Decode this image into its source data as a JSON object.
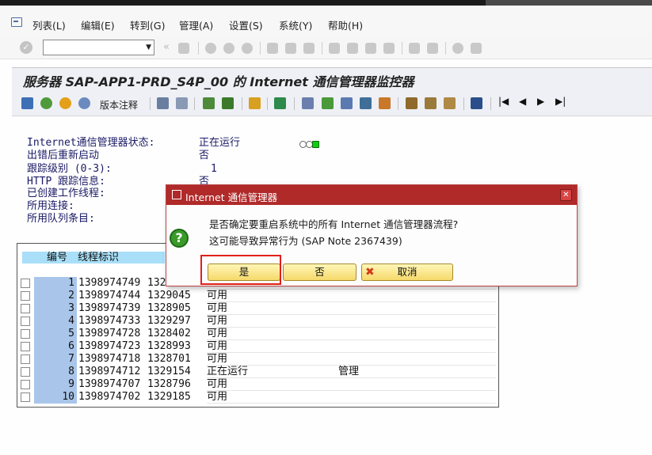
{
  "menu": {
    "items": [
      "列表(L)",
      "编辑(E)",
      "转到(G)",
      "管理(A)",
      "设置(S)",
      "系统(Y)",
      "帮助(H)"
    ]
  },
  "toolbar": {
    "command_value": "",
    "icons": [
      "enter-icon",
      "save-icon",
      "back-icon",
      "exit-icon",
      "cancel-icon",
      "print-icon",
      "find-icon",
      "find-next-icon",
      "first-page-icon",
      "prev-page-icon",
      "next-page-icon",
      "last-page-icon",
      "new-session-icon",
      "shortcut-icon",
      "help-icon",
      "layout-icon"
    ]
  },
  "title": "服务器 SAP-APP1-PRD_S4P_00 的 Internet 通信管理器监控器",
  "app_toolbar": {
    "notes_label": "版本注释"
  },
  "status": {
    "labels": [
      "Internet通信管理器状态:",
      "出错后重新启动",
      "跟踪级别 (0-3):",
      "HTTP 跟踪信息:",
      "已创建工作线程:",
      "所用连接:",
      "所用队列条目:"
    ],
    "state": "正在运行",
    "restart": "否",
    "trace_level": "1",
    "http_trace": "否",
    "traffic_light_colors": [
      "#ffffff",
      "#ffffff",
      "#11cc11"
    ]
  },
  "table": {
    "headers": [
      "编号",
      "线程标识"
    ],
    "rows": [
      {
        "no": "1",
        "tid": "1398974749",
        "pid": "1328",
        "status": "",
        "user": ""
      },
      {
        "no": "2",
        "tid": "1398974744",
        "pid": "1329045",
        "status": "可用",
        "user": ""
      },
      {
        "no": "3",
        "tid": "1398974739",
        "pid": "1328905",
        "status": "可用",
        "user": ""
      },
      {
        "no": "4",
        "tid": "1398974733",
        "pid": "1329297",
        "status": "可用",
        "user": ""
      },
      {
        "no": "5",
        "tid": "1398974728",
        "pid": "1328402",
        "status": "可用",
        "user": ""
      },
      {
        "no": "6",
        "tid": "1398974723",
        "pid": "1328993",
        "status": "可用",
        "user": ""
      },
      {
        "no": "7",
        "tid": "1398974718",
        "pid": "1328701",
        "status": "可用",
        "user": ""
      },
      {
        "no": "8",
        "tid": "1398974712",
        "pid": "1329154",
        "status": "正在运行",
        "user": "管理"
      },
      {
        "no": "9",
        "tid": "1398974707",
        "pid": "1328796",
        "status": "可用",
        "user": ""
      },
      {
        "no": "10",
        "tid": "1398974702",
        "pid": "1329185",
        "status": "可用",
        "user": ""
      }
    ]
  },
  "dialog": {
    "title": "Internet 通信管理器",
    "message_line1": "是否确定要重启系统中的所有 Internet 通信管理器流程?",
    "message_line2": "这可能导致异常行为 (SAP Note 2367439)",
    "yes_label": "是",
    "no_label": "否",
    "cancel_label": "取消",
    "highlight_color": "#e0201a"
  }
}
